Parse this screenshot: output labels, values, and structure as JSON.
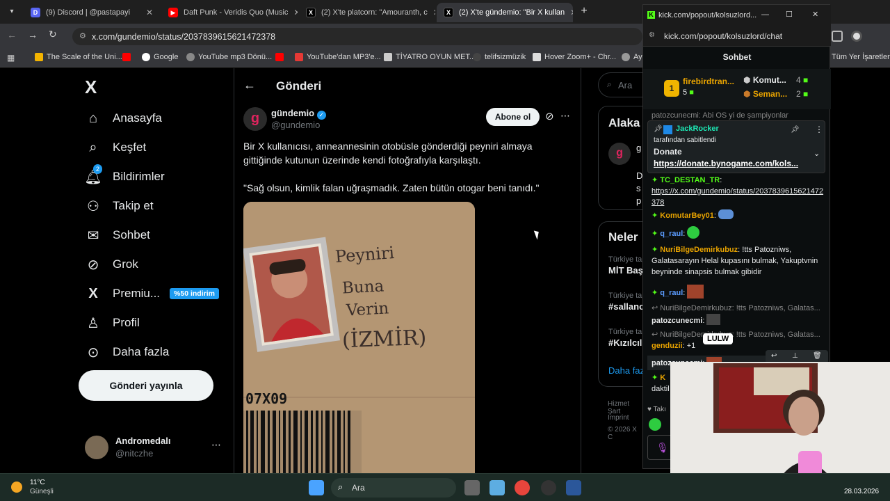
{
  "browser": {
    "tabs": [
      {
        "label": "(9) Discord | @pastapayi",
        "icon_color": "#5865f2"
      },
      {
        "label": "Daft Punk - Veridis Quo (Music",
        "icon_color": "#ff0000"
      },
      {
        "label": "(2) X'te platcorn: \"Amouranth, c",
        "icon_color": "#000000"
      },
      {
        "label": "(2) X'te gündemio: \"Bir X kullan",
        "icon_color": "#000000"
      }
    ],
    "new_tab": "+",
    "url": "x.com/gundemio/status/2037839615621472378",
    "bookmarks": [
      "The Scale of the Uni...",
      "Google",
      "YouTube mp3 Dönü...",
      "YouTube'dan MP3'e...",
      "TİYATRO OYUN MET...",
      "telifsizmüzik",
      "Hover Zoom+ - Chr...",
      "Ay"
    ],
    "all_bookmarks": "Tüm Yer İşaretleri"
  },
  "x": {
    "logo": "X",
    "nav": [
      {
        "label": "Anasayfa",
        "icon": "home-icon"
      },
      {
        "label": "Keşfet",
        "icon": "search-icon"
      },
      {
        "label": "Bildirimler",
        "icon": "bell-icon",
        "badge": "2"
      },
      {
        "label": "Takip et",
        "icon": "follow-icon"
      },
      {
        "label": "Sohbet",
        "icon": "mail-icon"
      },
      {
        "label": "Grok",
        "icon": "grok-icon"
      },
      {
        "label": "Premiu...",
        "icon": "x-icon",
        "badge": "%50 indirim"
      },
      {
        "label": "Profil",
        "icon": "profile-icon"
      },
      {
        "label": "Daha fazla",
        "icon": "more-icon"
      }
    ],
    "post_button": "Gönderi yayınla",
    "account": {
      "name": "Andromedalı",
      "handle": "@nitczhe"
    },
    "header_title": "Gönderi",
    "tweet": {
      "author": "gündemio",
      "handle": "@gundemio",
      "subscribe": "Abone ol",
      "text1": "Bir X kullanıcısı, anneannesinin otobüsle gönderdiği peyniri almaya gittiğinde kutunun üzerinde kendi fotoğrafıyla karşılaştı.",
      "text2": "\"Sağ olsun, kimlik falan uğraşmadık. Zaten bütün otogar beni tanıdı.\"",
      "image_text": [
        "Peyniri",
        "Buna",
        "Verin",
        "(İZMİR)"
      ],
      "image_code": "07X09"
    },
    "right": {
      "search": "Ara",
      "alaka": "Alaka",
      "neler": "Neler",
      "trends": [
        {
          "meta": "Türkiye ta",
          "name": "MİT Baş"
        },
        {
          "meta": "Türkiye ta",
          "name": "#sallanc"
        },
        {
          "meta": "Türkiye ta",
          "name": "#Kızılcıl"
        }
      ],
      "more": "Daha faz",
      "footer": [
        "Hizmet Şart",
        "Imprint",
        "© 2026 X C"
      ],
      "snippet": [
        "g",
        "D",
        "s",
        "p"
      ]
    }
  },
  "kick": {
    "title": "kick.com/popout/kolsuzlord...",
    "url": "kick.com/popout/kolsuzlord/chat",
    "header": "Sohbet",
    "leaderboard": [
      {
        "rank": "1",
        "name": "firebirdtran...",
        "count": "5"
      },
      {
        "name": "Komut...",
        "count": "4"
      },
      {
        "name": "Seman...",
        "count": "2"
      }
    ],
    "peek": "patozcunecmi: Abi OS yi de şampiyonlar",
    "pinned": {
      "by": "JackRocker",
      "by_suffix": "tarafından sabitlendi",
      "title": "Donate",
      "link": "https://donate.bynogame.com/kols..."
    },
    "messages": [
      {
        "user": "TC_DESTAN_TR",
        "text": "https://x.com/gundemio/status/2037839615621472378"
      },
      {
        "user": "KomutarBey01",
        "text": ""
      },
      {
        "user": "q_raul",
        "text": ""
      },
      {
        "user": "NuriBilgeDemirkubuz",
        "text": "!tts Patozniws, Galatasarayın Helal kupasını bulmak, Yakuptvnin beyninde sinapsis bulmak gibidir"
      },
      {
        "user": "q_raul",
        "text": ""
      },
      {
        "reply": "NuriBilgeDemirkubuz: !tts Patozniws, Galatas...",
        "user": "patozcunecmi",
        "text": ""
      },
      {
        "reply": "NuriBilgeDemirkubuz: !tts Patozniws, Galatas...",
        "user": "genduzii",
        "text": "+1"
      },
      {
        "user": "patozcunecmi",
        "text": ""
      },
      {
        "user": "K",
        "text": "daktil"
      }
    ],
    "tooltip": "LULW",
    "bottom": "Takı"
  },
  "taskbar": {
    "weather_temp": "11°C",
    "weather_desc": "Güneşli",
    "search": "Ara",
    "date": "28.03.2026"
  },
  "colors": {
    "accent": "#1d9bf0",
    "kick_green": "#53fc18",
    "premium_badge": "#1d9bf0"
  }
}
